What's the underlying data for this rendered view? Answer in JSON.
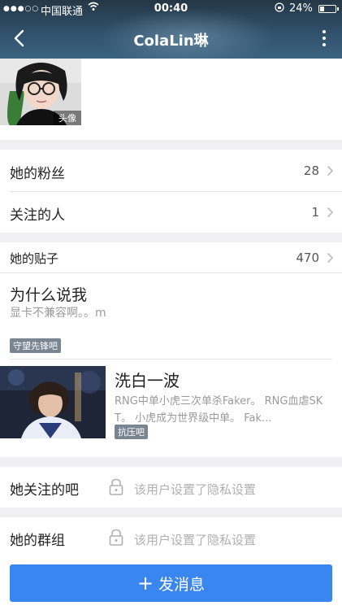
{
  "status_bar": {
    "signal": "●●●○○",
    "carrier": "中国联通",
    "time": "00:40",
    "battery": "24%"
  },
  "nav": {
    "title": "ColaLin琳"
  },
  "profile": {
    "avatar_caption": "头像"
  },
  "stats": {
    "fans_label": "她的粉丝",
    "fans_count": "28",
    "following_label": "关注的人",
    "following_count": "1"
  },
  "posts_section": {
    "label": "她的贴子",
    "count": "470",
    "post1": {
      "title": "为什么说我",
      "subtitle": "显卡不兼容啊。。m",
      "tag": "守望先锋吧"
    },
    "post2": {
      "title": "洗白一波",
      "body": "RNG中单小虎三次单杀Faker。 RNG血虐SKT。 小虎成为世界级中单。 Fak...",
      "tag": "抗压吧"
    }
  },
  "privacy": {
    "bars_label": "她关注的吧",
    "groups_label": "她的群组",
    "private_text": "该用户设置了隐私设置"
  },
  "action": {
    "plus": "+",
    "label": "发消息"
  },
  "colors": {
    "accent": "#3a86f0",
    "tag_bg": "#7a8592",
    "section_gap": "#f0f0f2"
  }
}
